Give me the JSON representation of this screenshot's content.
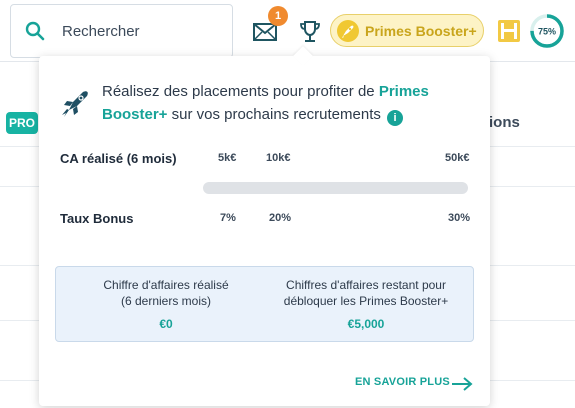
{
  "search": {
    "placeholder": "Rechercher"
  },
  "notifications": {
    "count": "1"
  },
  "booster": {
    "label": "Primes Booster+"
  },
  "progress_gauge": {
    "label": "75%",
    "value_percent": 75
  },
  "background": {
    "badge": "PRO",
    "column_header": "tions"
  },
  "popover": {
    "headline_prefix": "Réalisez des placements pour profiter de ",
    "headline_highlight": "Primes Booster+",
    "headline_suffix": " sur vos prochains recrutements",
    "info_icon": "i",
    "ca_label": "CA réalisé (6 mois)",
    "ca_ticks": [
      "5k€",
      "10k€",
      "50k€"
    ],
    "bonus_label": "Taux Bonus",
    "bonus_ticks": [
      "7%",
      "20%",
      "30%"
    ],
    "progress_fill_fraction": 0,
    "box": {
      "left_title": "Chiffre d'affaires réalisé",
      "left_subtitle": "(6 derniers mois)",
      "left_value": "€0",
      "right_title": "Chiffres d'affaires restant pour",
      "right_subtitle": "débloquer les Primes Booster+",
      "right_value": "€5,000"
    },
    "cta": "EN SAVOIR PLUS"
  },
  "colors": {
    "teal": "#17a398",
    "orange": "#f08a2e",
    "gold": "#f0c832"
  }
}
